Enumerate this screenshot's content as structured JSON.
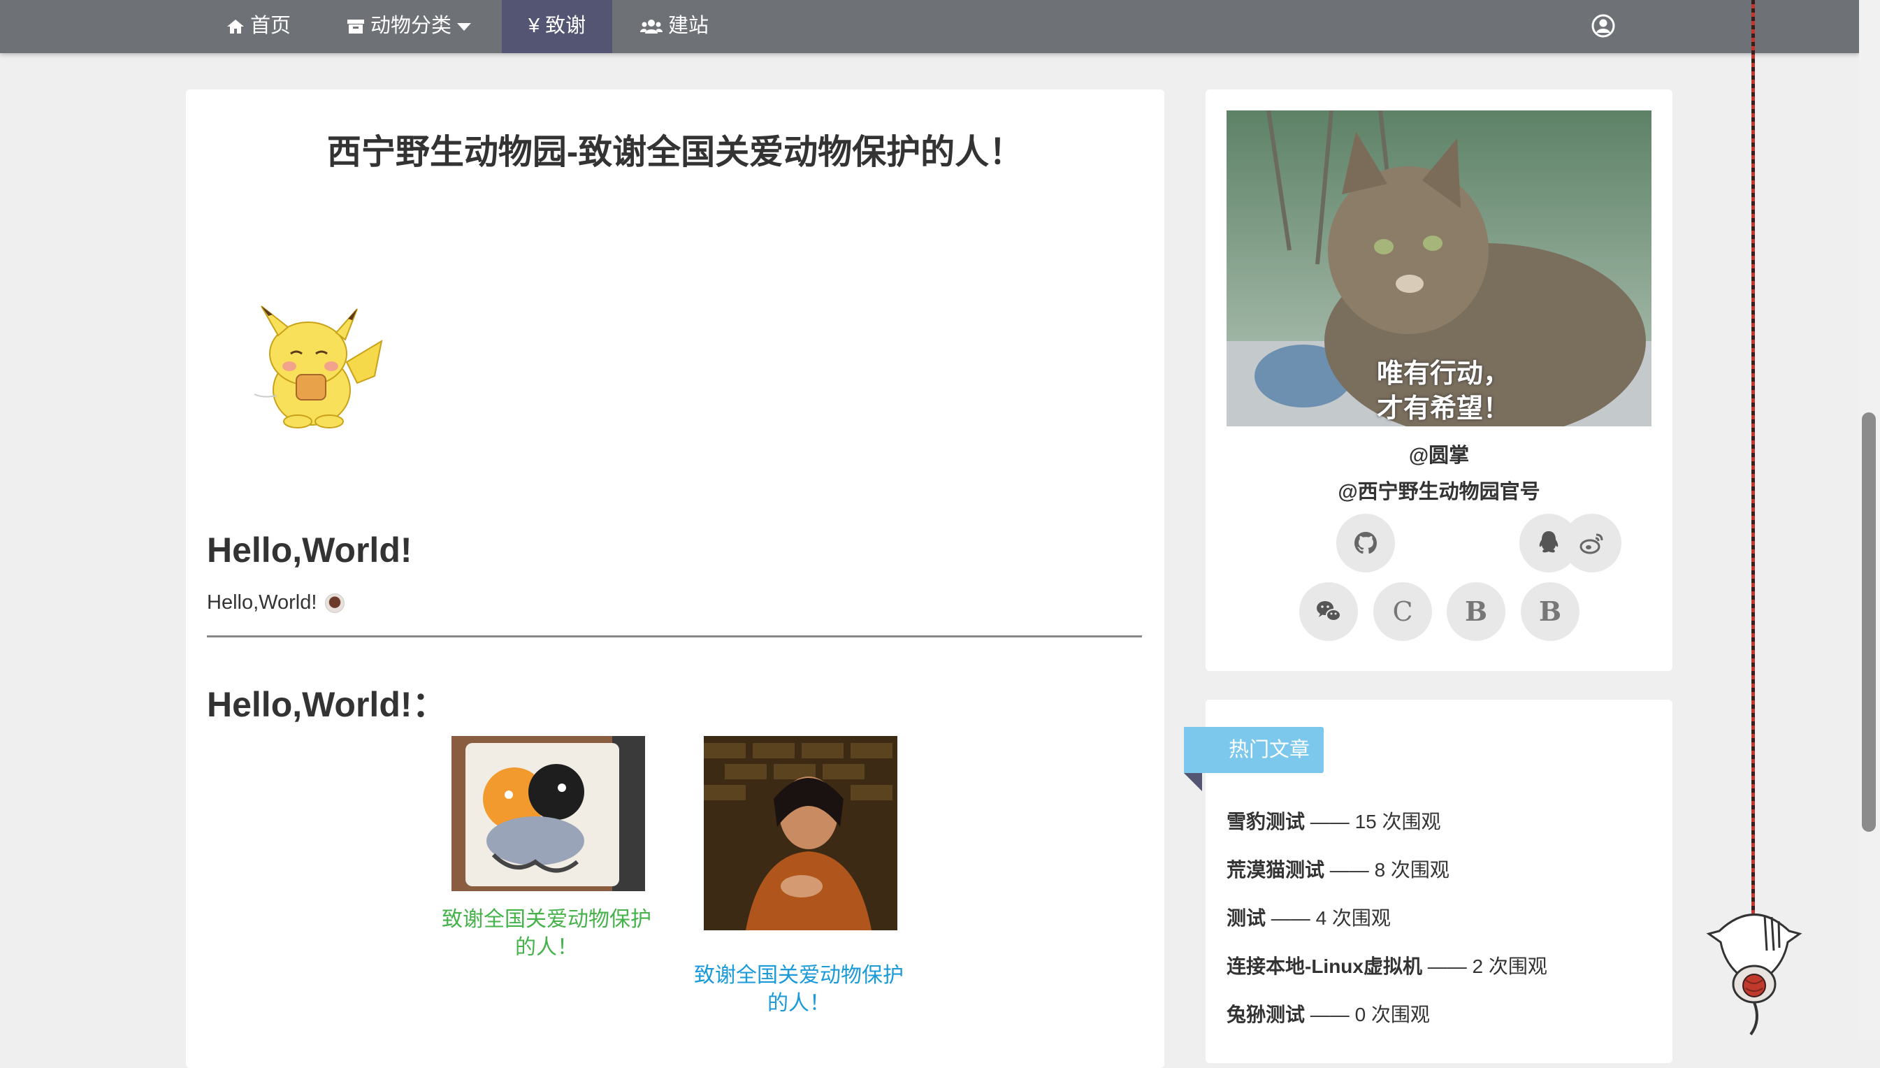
{
  "nav": {
    "home": "首页",
    "categories": "动物分类",
    "thanks": "¥ 致谢",
    "build": "建站"
  },
  "post": {
    "title": "西宁野生动物园-致谢全国关爱动物保护的人！",
    "heading1": "Hello,World!",
    "paragraph": "Hello,World!",
    "heading2": "Hello,World!：",
    "captions": [
      "致谢全国关爱动物保护的人！",
      "致谢全国关爱动物保护的人！"
    ]
  },
  "profile": {
    "photo_caption_line1": "唯有行动，",
    "photo_caption_line2": "才有希望！",
    "handle1": "@圆掌",
    "handle2": "@西宁野生动物园官号",
    "social": [
      {
        "icon": "github-icon"
      },
      {
        "icon": "qq-icon"
      },
      {
        "icon": "weibo-icon"
      },
      {
        "icon": "wechat-icon"
      },
      {
        "label": "C"
      },
      {
        "label": "B"
      },
      {
        "label": "B"
      }
    ]
  },
  "hot": {
    "title": "热门文章",
    "items": [
      {
        "name": "雪豹测试",
        "views": "—— 15 次围观"
      },
      {
        "name": "荒漠猫测试",
        "views": "—— 8 次围观"
      },
      {
        "name": "测试",
        "views": "—— 4 次围观"
      },
      {
        "name": "连接本地-Linux虚拟机",
        "views": "—— 2 次围观"
      },
      {
        "name": "兔狲测试",
        "views": "—— 0 次围观"
      }
    ]
  },
  "colors": {
    "navbar": "#6e7277",
    "nav_active": "#535573",
    "caption_green": "#45b24a",
    "caption_blue": "#1a9ad8",
    "ribbon": "#7cc8ec"
  }
}
